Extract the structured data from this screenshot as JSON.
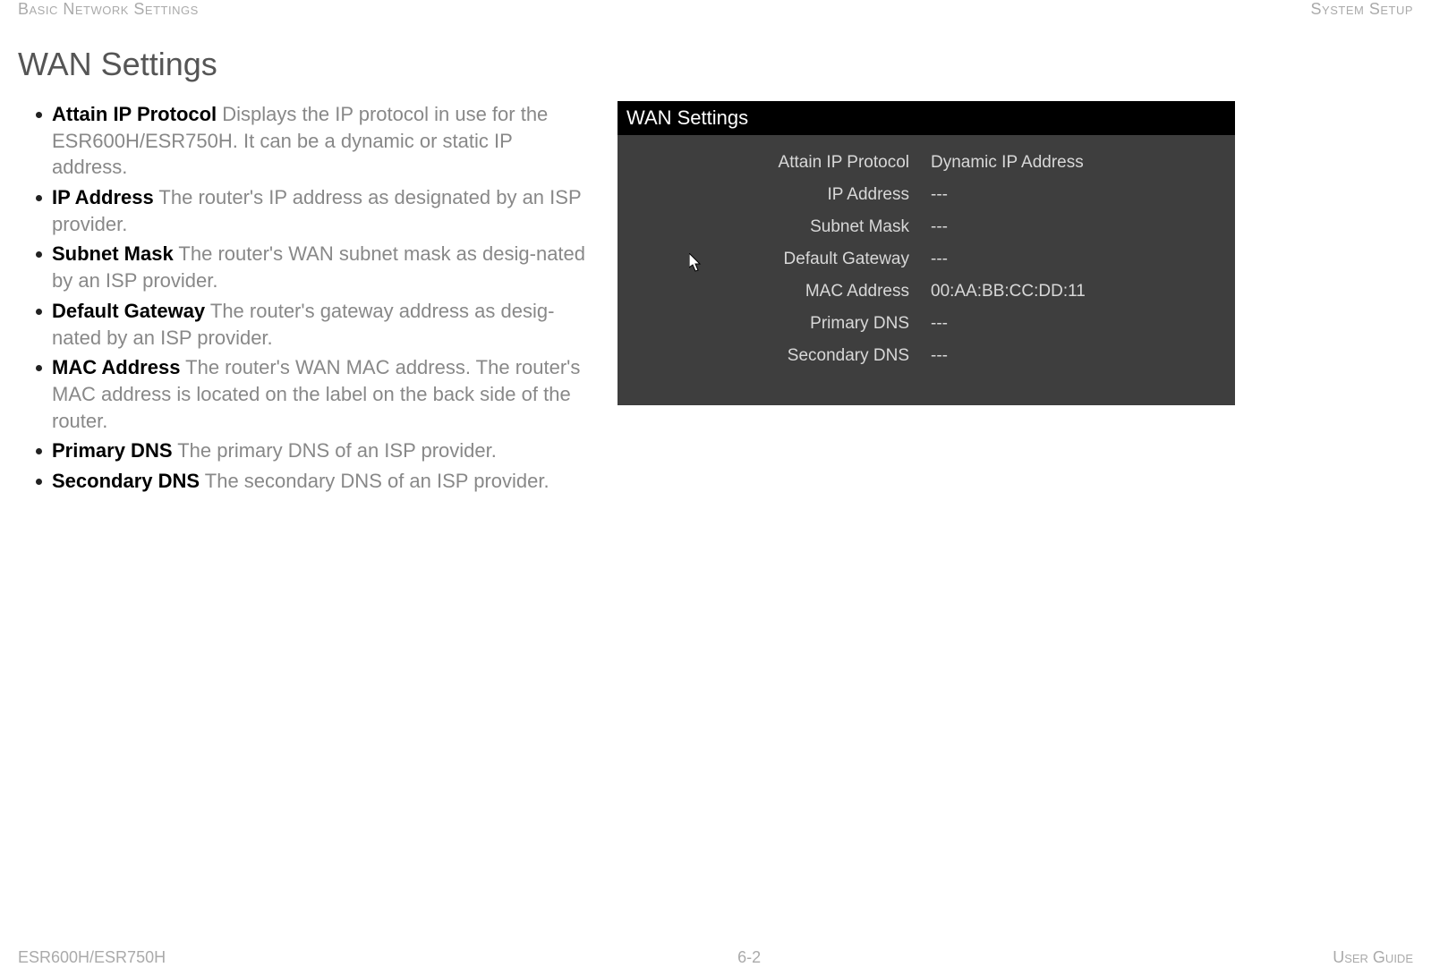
{
  "header": {
    "left": "Basic Network Settings",
    "right": "System Setup"
  },
  "title": "WAN Settings",
  "bullets": [
    {
      "term": "Attain IP Protocol",
      "desc": "  Displays the IP protocol in use for the ESR600H/ESR750H. It can be a dynamic or static IP address."
    },
    {
      "term": "IP Address",
      "desc": "  The router's IP address as designated by an ISP provider."
    },
    {
      "term": "Subnet Mask",
      "desc": "  The router's WAN subnet mask as desig-nated by an ISP provider."
    },
    {
      "term": "Default Gateway",
      "desc": "  The router's gateway address as desig-nated by an ISP provider."
    },
    {
      "term": "MAC Address",
      "desc": "  The router's WAN MAC address. The router's MAC address is located on the label on the back side of the router."
    },
    {
      "term": "Primary DNS",
      "desc": "  The primary DNS of an ISP provider."
    },
    {
      "term": "Secondary DNS",
      "desc": "  The secondary DNS of an ISP provider."
    }
  ],
  "panel": {
    "title": "WAN Settings",
    "rows": [
      {
        "label": "Attain IP Protocol",
        "value": "Dynamic IP Address"
      },
      {
        "label": "IP Address",
        "value": "---"
      },
      {
        "label": "Subnet Mask",
        "value": "---"
      },
      {
        "label": "Default Gateway",
        "value": "---"
      },
      {
        "label": "MAC Address",
        "value": "00:AA:BB:CC:DD:11"
      },
      {
        "label": "Primary DNS",
        "value": "---"
      },
      {
        "label": "Secondary DNS",
        "value": "---"
      }
    ]
  },
  "footer": {
    "left": "ESR600H/ESR750H",
    "center": "6-2",
    "right": "User Guide"
  }
}
